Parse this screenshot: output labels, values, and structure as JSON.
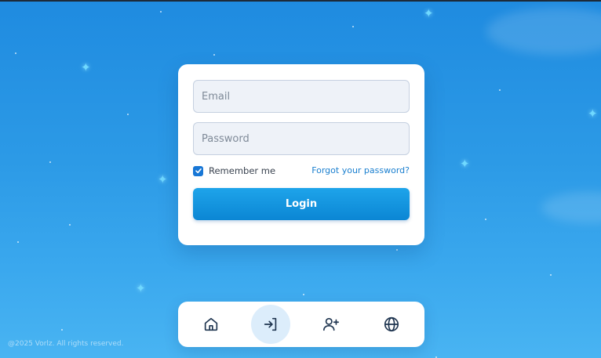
{
  "login_form": {
    "email_placeholder": "Email",
    "password_placeholder": "Password",
    "remember_label": "Remember me",
    "remember_checked": true,
    "forgot_label": "Forgot your password?",
    "login_label": "Login"
  },
  "bottom_nav": {
    "items": [
      {
        "icon": "home-icon",
        "active": false
      },
      {
        "icon": "login-icon",
        "active": true
      },
      {
        "icon": "user-plus-icon",
        "active": false
      },
      {
        "icon": "globe-icon",
        "active": false
      }
    ]
  },
  "footer": {
    "copyright": "@2025 Vorlz. All rights reserved."
  },
  "colors": {
    "accent": "#1a7fcf",
    "button": "#0b86d4",
    "nav_active_bg": "#dcedfb",
    "icon": "#1f3550"
  }
}
